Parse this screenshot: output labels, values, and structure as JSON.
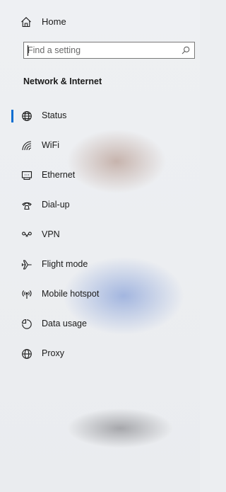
{
  "home": {
    "label": "Home",
    "icon": "home-icon"
  },
  "search": {
    "placeholder": "Find a setting",
    "value": "",
    "icon": "search-icon"
  },
  "section": {
    "title": "Network & Internet"
  },
  "nav": {
    "selected": "Status",
    "accent_color": "#0a6ed1",
    "items": [
      {
        "label": "Status",
        "icon": "globe-status-icon"
      },
      {
        "label": "WiFi",
        "icon": "wifi-icon"
      },
      {
        "label": "Ethernet",
        "icon": "ethernet-icon"
      },
      {
        "label": "Dial-up",
        "icon": "dial-up-icon"
      },
      {
        "label": "VPN",
        "icon": "vpn-icon"
      },
      {
        "label": "Flight mode",
        "icon": "airplane-icon"
      },
      {
        "label": "Mobile hotspot",
        "icon": "hotspot-icon"
      },
      {
        "label": "Data usage",
        "icon": "data-usage-icon"
      },
      {
        "label": "Proxy",
        "icon": "globe-icon"
      }
    ]
  }
}
